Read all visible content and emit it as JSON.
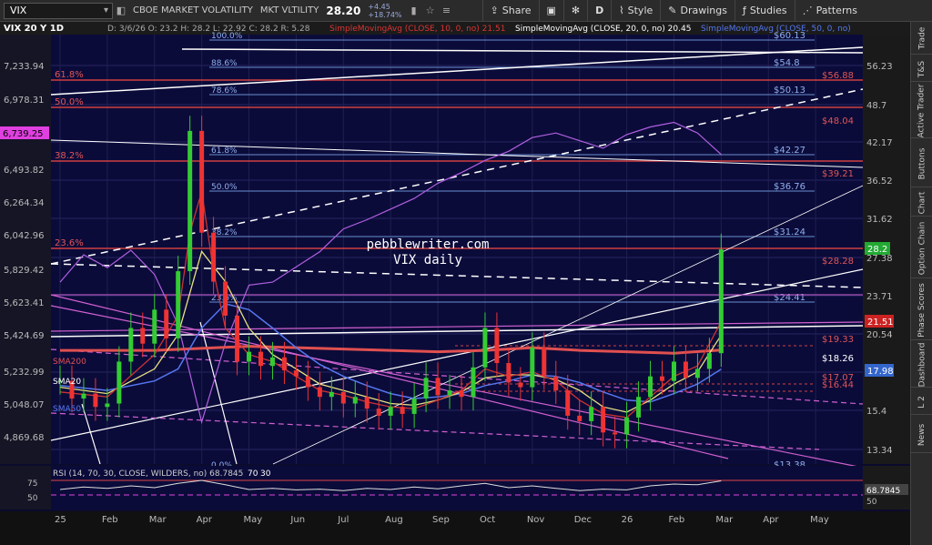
{
  "toolbar": {
    "symbol": "VIX",
    "symbol_desc": "CBOE MARKET VOLATILITY",
    "symbol_short": "MKT VLTILITY",
    "last": "28.20",
    "change_abs": "+4.45",
    "change_pct": "+18.74%",
    "share": "Share",
    "period": "D",
    "style": "Style",
    "drawings": "Drawings",
    "studies": "Studies",
    "patterns": "Patterns"
  },
  "sidebar": {
    "tabs": [
      "Trade",
      "T&S",
      "Active Trader",
      "Buttons",
      "Chart",
      "Option Chain",
      "Phase Scores",
      "Dashboard",
      "L 2",
      "News"
    ]
  },
  "chart_data": {
    "type": "line",
    "header": {
      "title": "VIX 20 Y 1D",
      "ohlc": "D: 3/6/26  O: 23.2  H: 28.2  L: 22.92  C: 28.2  R: 5.28",
      "sma10": "SimpleMovingAvg (CLOSE, 10, 0, no) 21.51",
      "sma20": "SimpleMovingAvg (CLOSE, 20, 0, no) 20.45",
      "sma50": "SimpleMovingAvg (CLOSE, 50, 0, no)"
    },
    "watermark": [
      "pebblewriter.com",
      "VIX daily"
    ],
    "x_labels": [
      "25",
      "Feb",
      "Mar",
      "Apr",
      "May",
      "Jun",
      "Jul",
      "Aug",
      "Sep",
      "Oct",
      "Nov",
      "Dec",
      "26",
      "Feb",
      "Mar",
      "Apr",
      "May"
    ],
    "x_label_pos": [
      0,
      2,
      4,
      6,
      8,
      10,
      12,
      14,
      16,
      18,
      20,
      22,
      24,
      26,
      28,
      30,
      32
    ],
    "right_axis": {
      "labels": [
        56.23,
        48.7,
        42.17,
        36.52,
        31.62,
        27.38,
        23.71,
        20.54,
        17.78,
        15.4,
        13.34
      ],
      "px": [
        48,
        91,
        132,
        174,
        216,
        259,
        301,
        343,
        385,
        427,
        470
      ]
    },
    "left_axis": {
      "labels": [
        "7,233.94",
        "6,978.31",
        "6,493.82",
        "6,264.34",
        "6,042.96",
        "5,829.42",
        "5,623.41",
        "5,424.69",
        "5,232.99",
        "5,048.07",
        "4,869.68"
      ],
      "spx_mark": "6,739.25",
      "spx_mark_color": "#e040e0"
    },
    "last_price": {
      "value": "28.2",
      "color": "#22aa33"
    },
    "price_tags": [
      {
        "value": "21.51",
        "color": "#cc2222"
      },
      {
        "value": "17.98",
        "color": "#3366cc"
      }
    ],
    "fib_left": [
      {
        "label": "100.0%"
      },
      {
        "label": "88.6%"
      },
      {
        "label": "78.6%"
      },
      {
        "label": "61.8%"
      },
      {
        "label": "50.0%"
      },
      {
        "label": "38.2%"
      },
      {
        "label": "23.6%"
      },
      {
        "label": "0.0%"
      }
    ],
    "fib_right": [
      "$60.13",
      "$54.8",
      "$50.13",
      "$42.27",
      "$36.76",
      "$31.24",
      "$24.41",
      "$13.38"
    ],
    "red_left": [
      "61.8%",
      "50.0%",
      "38.2%",
      "23.6%"
    ],
    "red_right": [
      "$56.88",
      "$48.04",
      "$39.21",
      "$28.28",
      "$19.33",
      "$17.07",
      "$16.44"
    ],
    "white_right": [
      "$18.26"
    ],
    "sma_labels": [
      "SMA200",
      "SMA20",
      "SMA50"
    ],
    "candle_points": {
      "x": [
        0,
        0.5,
        1,
        1.5,
        2,
        2.5,
        3,
        3.5,
        4,
        4.5,
        5,
        5.5,
        6,
        6.5,
        7,
        7.5,
        8,
        8.5,
        9,
        9.5,
        10,
        10.5,
        11,
        11.5,
        12,
        12.5,
        13,
        13.5,
        14,
        14.5,
        15,
        15.5,
        16,
        16.5,
        17,
        17.5,
        18,
        18.5,
        19,
        19.5,
        20,
        20.5,
        21,
        21.5,
        22,
        22.5,
        23,
        23.5,
        24,
        24.5,
        25,
        25.5,
        26,
        26.5,
        27,
        27.5,
        28
      ],
      "y": [
        17.2,
        16.1,
        16.4,
        15.6,
        15.8,
        18.5,
        21,
        19.8,
        22.5,
        20.2,
        26,
        44,
        30,
        25,
        22,
        18.5,
        19.2,
        18.2,
        18.8,
        17.9,
        17.5,
        16.8,
        16.2,
        16.5,
        15.8,
        16.2,
        15.5,
        15.1,
        15.6,
        15.2,
        16.1,
        17.4,
        16.3,
        16.6,
        16.2,
        18.1,
        21,
        18.4,
        17.1,
        16.8,
        19.5,
        17.5,
        16.6,
        15.1,
        14.8,
        15.6,
        14.2,
        14.1,
        15,
        16.2,
        17.5,
        17.2,
        18.5,
        17.4,
        18,
        19.1,
        28.2
      ]
    },
    "spx_points": {
      "x": [
        0,
        1,
        2,
        3,
        4,
        5,
        6,
        7,
        8,
        9,
        10,
        11,
        12,
        13,
        14,
        15,
        16,
        17,
        18,
        19,
        20,
        21,
        22,
        23,
        24,
        25,
        26,
        27,
        28
      ],
      "y": [
        5900,
        6080,
        5995,
        6110,
        5950,
        5620,
        4980,
        5500,
        5880,
        5900,
        6000,
        6100,
        6250,
        6310,
        6380,
        6450,
        6550,
        6620,
        6700,
        6760,
        6850,
        6880,
        6830,
        6780,
        6870,
        6920,
        6950,
        6880,
        6739
      ]
    },
    "sma10_points": {
      "x": [
        0,
        2,
        4,
        5,
        5.5,
        6,
        6.5,
        7,
        8,
        9,
        10,
        11,
        12,
        13,
        14,
        15,
        16,
        17,
        18,
        19,
        20,
        21,
        22,
        23,
        24,
        25,
        26,
        27,
        28
      ],
      "y": [
        16.5,
        16.2,
        19,
        22,
        30,
        35,
        26,
        21,
        19,
        18.5,
        17.5,
        16.6,
        16.3,
        15.9,
        15.6,
        15.5,
        16,
        16.6,
        18,
        17.5,
        17.8,
        17.2,
        16,
        15.2,
        15,
        16.2,
        17.5,
        18.2,
        21.5
      ]
    },
    "sma20_points": {
      "x": [
        0,
        2,
        4,
        5,
        6,
        7,
        8,
        9,
        10,
        11,
        12,
        13,
        14,
        15,
        16,
        17,
        18,
        19,
        20,
        21,
        22,
        23,
        24,
        25,
        26,
        27,
        28
      ],
      "y": [
        16.8,
        16.4,
        18,
        20.5,
        28,
        25,
        21,
        19,
        18,
        17,
        16.6,
        16.2,
        15.8,
        15.7,
        16,
        16.5,
        17.4,
        17.6,
        17.6,
        17.3,
        16.6,
        15.6,
        15.3,
        16,
        17,
        17.8,
        20.45
      ]
    },
    "sma50_points": {
      "x": [
        0,
        2,
        4,
        5,
        6,
        7,
        8,
        9,
        10,
        11,
        12,
        13,
        14,
        15,
        16,
        17,
        18,
        19,
        20,
        21,
        22,
        23,
        24,
        25,
        26,
        27,
        28
      ],
      "y": [
        16.9,
        16.6,
        17.2,
        18,
        21,
        23,
        22.5,
        21,
        19.5,
        18.3,
        17.5,
        16.9,
        16.4,
        16.1,
        16.2,
        16.4,
        16.9,
        17.2,
        17.6,
        17.5,
        17.1,
        16.5,
        16,
        15.9,
        16.4,
        17,
        17.98
      ]
    },
    "sma200_points": {
      "x": [
        0,
        4,
        8,
        12,
        16,
        18,
        20,
        22,
        24,
        26,
        28
      ],
      "y": [
        19.3,
        19.3,
        19.6,
        19.4,
        19.2,
        19.3,
        19.5,
        19.3,
        19.2,
        19.1,
        19.33
      ]
    },
    "rsi": {
      "label": "RSI (14, 70, 30, CLOSE, WILDERS, no) 68.7845",
      "levels": [
        "30",
        "70"
      ],
      "axis": [
        "75",
        "50"
      ],
      "value": "68.7845",
      "x": [
        0,
        1,
        2,
        3,
        4,
        5,
        6,
        7,
        8,
        9,
        10,
        11,
        12,
        13,
        14,
        15,
        16,
        17,
        18,
        19,
        20,
        21,
        22,
        23,
        24,
        25,
        26,
        27,
        28
      ],
      "y": [
        45,
        52,
        48,
        55,
        50,
        62,
        70,
        58,
        45,
        48,
        44,
        46,
        42,
        48,
        45,
        52,
        47,
        55,
        62,
        50,
        55,
        48,
        42,
        46,
        44,
        55,
        60,
        58,
        68.78
      ]
    }
  }
}
